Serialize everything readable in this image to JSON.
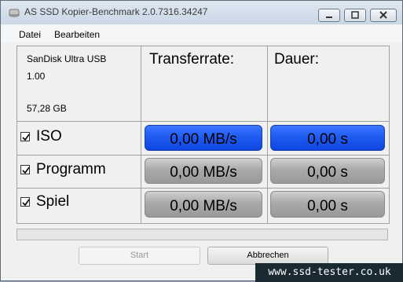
{
  "window": {
    "title": "AS SSD Kopier-Benchmark 2.0.7316.34247"
  },
  "menu": {
    "items": [
      "Datei",
      "Bearbeiten"
    ]
  },
  "device": {
    "name": "SanDisk Ultra USB",
    "firmware": "1.00",
    "size": "57,28 GB"
  },
  "headers": {
    "rate": "Transferrate:",
    "duration": "Dauer:"
  },
  "rows": [
    {
      "label": "ISO",
      "checked": true,
      "rate": "0,00 MB/s",
      "duration": "0,00 s"
    },
    {
      "label": "Programm",
      "checked": true,
      "rate": "0,00 MB/s",
      "duration": "0,00 s"
    },
    {
      "label": "Spiel",
      "checked": true,
      "rate": "0,00 MB/s",
      "duration": "0,00 s"
    }
  ],
  "progress": {
    "value": 0
  },
  "buttons": {
    "start": "Start",
    "abort": "Abbrechen"
  },
  "watermark": "www.ssd-tester.co.uk",
  "colors": {
    "active_bar": "#1f5cf2",
    "idle_bar": "#a9a9a9"
  }
}
